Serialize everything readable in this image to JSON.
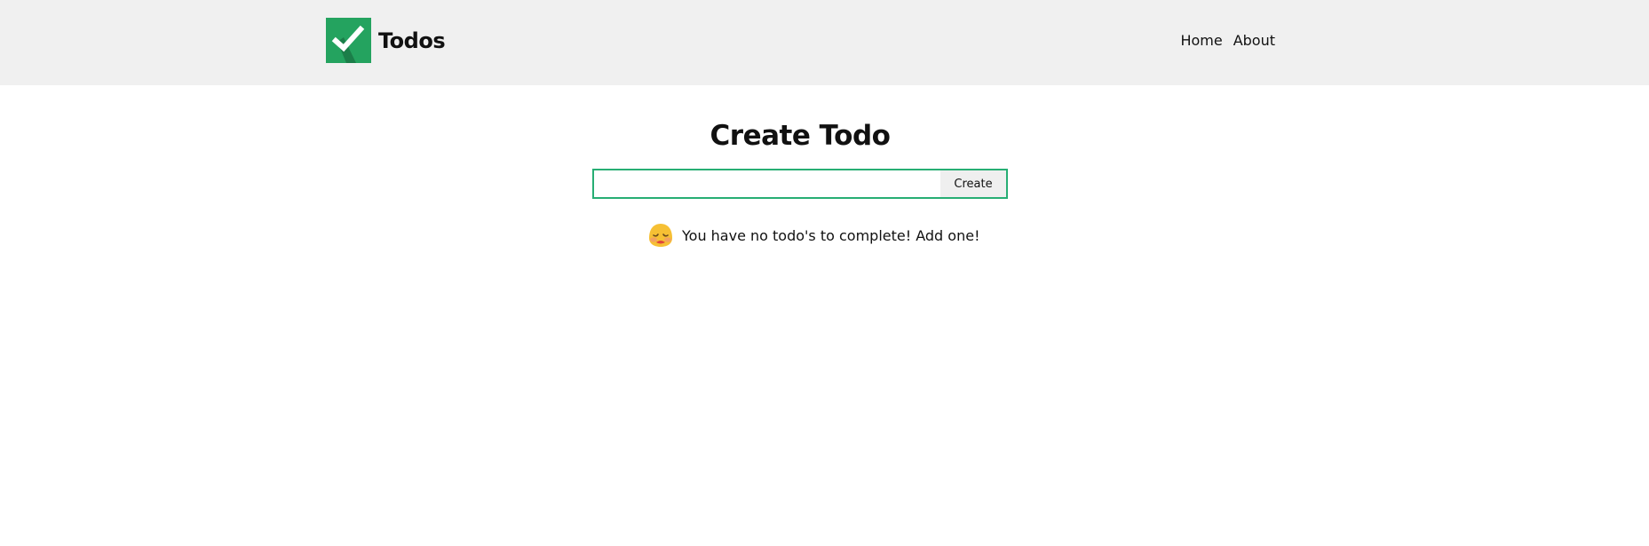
{
  "header": {
    "brand_title": "Todos",
    "logo_icon": "checkmark-icon",
    "brand_color": "#24a35f",
    "nav_links": [
      {
        "label": "Home"
      },
      {
        "label": "About"
      }
    ]
  },
  "main": {
    "heading": "Create Todo",
    "todo_input": {
      "value": "",
      "placeholder": ""
    },
    "create_button_label": "Create",
    "accent_color": "#27ae74",
    "empty_state": {
      "icon": "sad-face-icon",
      "message": "You have no todo's to complete! Add one!"
    }
  }
}
